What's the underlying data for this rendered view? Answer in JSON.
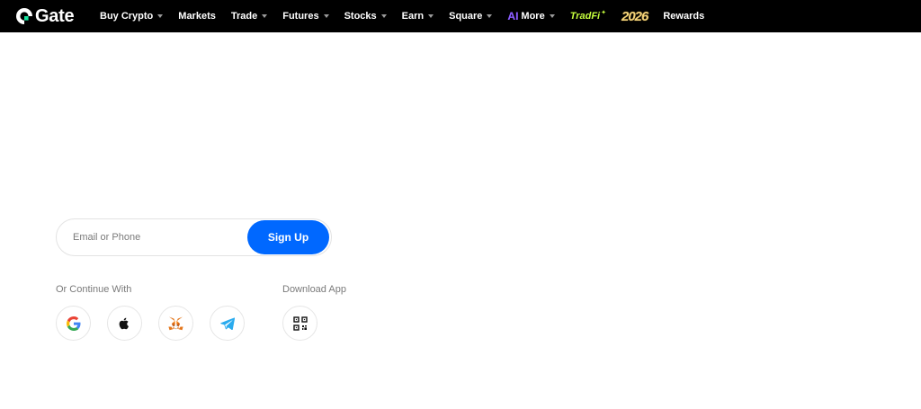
{
  "brand": {
    "name": "Gate"
  },
  "nav": {
    "items": [
      {
        "label": "Buy Crypto",
        "dropdown": true
      },
      {
        "label": "Markets",
        "dropdown": false
      },
      {
        "label": "Trade",
        "dropdown": true
      },
      {
        "label": "Futures",
        "dropdown": true
      },
      {
        "label": "Stocks",
        "dropdown": true
      },
      {
        "label": "Earn",
        "dropdown": true
      },
      {
        "label": "Square",
        "dropdown": true
      }
    ],
    "more": {
      "badge": "AI",
      "label": "More"
    },
    "tradfi": {
      "label": "TradFi",
      "star": "✦"
    },
    "year": "2026",
    "rewards": "Rewards"
  },
  "signup": {
    "placeholder": "Email or Phone",
    "button": "Sign Up"
  },
  "continue_with": {
    "label": "Or Continue With",
    "providers": [
      "google-icon",
      "apple-icon",
      "metamask-fox-icon",
      "telegram-icon"
    ]
  },
  "download": {
    "label": "Download App",
    "icon": "qr-code-icon"
  },
  "colors": {
    "topbar_bg": "#000000",
    "accent_blue": "#0068ff",
    "tradfi_green": "#c6ff3d",
    "ai_purple": "#8b5cff",
    "year_gold": "#f3d27a"
  }
}
